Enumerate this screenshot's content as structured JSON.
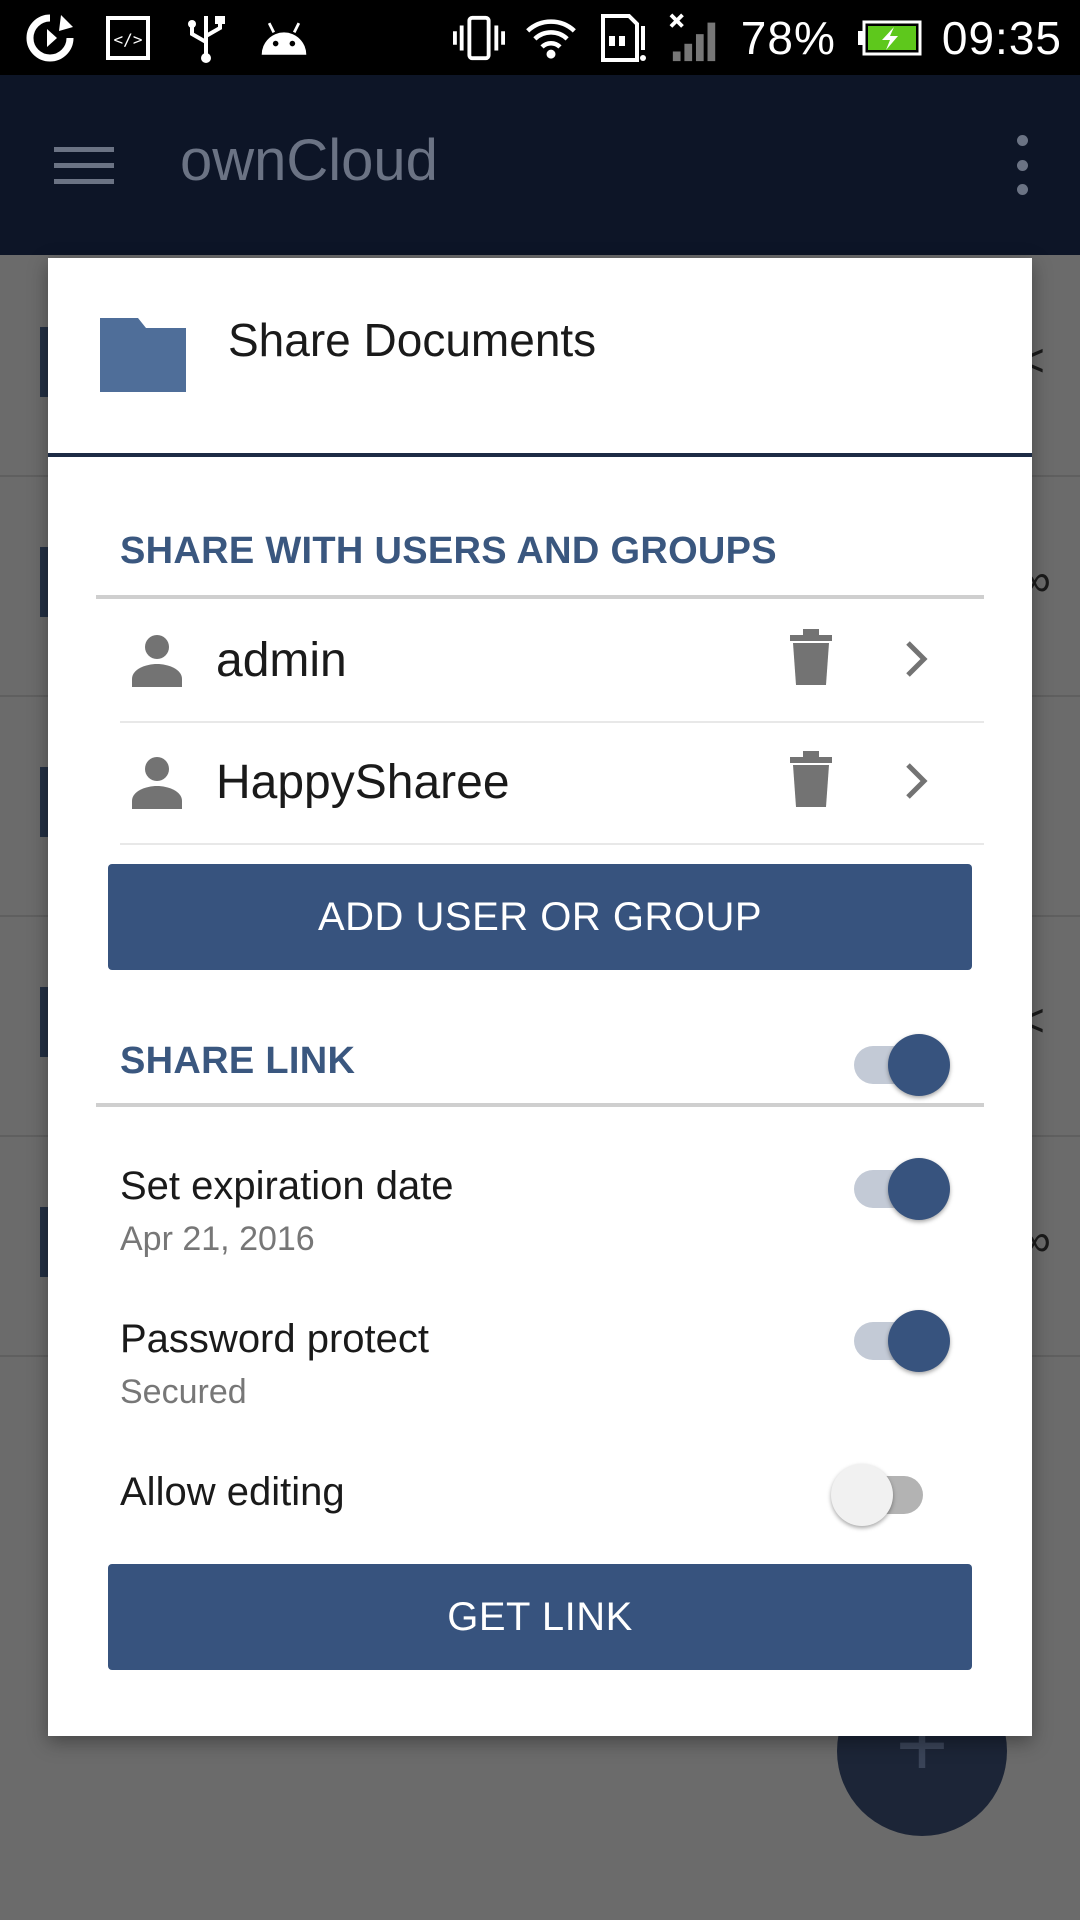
{
  "status_bar": {
    "battery_percent": "78%",
    "time": "09:35",
    "left_icons": [
      "sync-icon",
      "code-icon",
      "usb-icon",
      "android-icon"
    ],
    "right_icons": [
      "vibrate-icon",
      "wifi-icon",
      "sd-card-icon",
      "signal-icon",
      "battery-icon"
    ]
  },
  "app_bar": {
    "title": "ownCloud",
    "menu_icon": "hamburger-menu-icon",
    "overflow_icon": "overflow-menu-icon"
  },
  "dialog": {
    "title": "Share Documents",
    "folder_color": "#4f6e99",
    "users_section": {
      "title": "SHARE WITH USERS AND GROUPS",
      "users": [
        {
          "name": "admin"
        },
        {
          "name": "HappySharee"
        }
      ],
      "add_button": "ADD USER OR GROUP"
    },
    "link_section": {
      "title": "SHARE LINK",
      "enabled": true,
      "options": [
        {
          "label": "Set expiration date",
          "sublabel": "Apr 21, 2016",
          "enabled": true
        },
        {
          "label": "Password protect",
          "sublabel": "Secured",
          "enabled": true
        },
        {
          "label": "Allow editing",
          "enabled": false
        }
      ],
      "get_link_button": "GET LINK"
    }
  },
  "colors": {
    "accent": "#37537e",
    "section_title": "#3a577f",
    "app_bar": "#0d1527"
  }
}
